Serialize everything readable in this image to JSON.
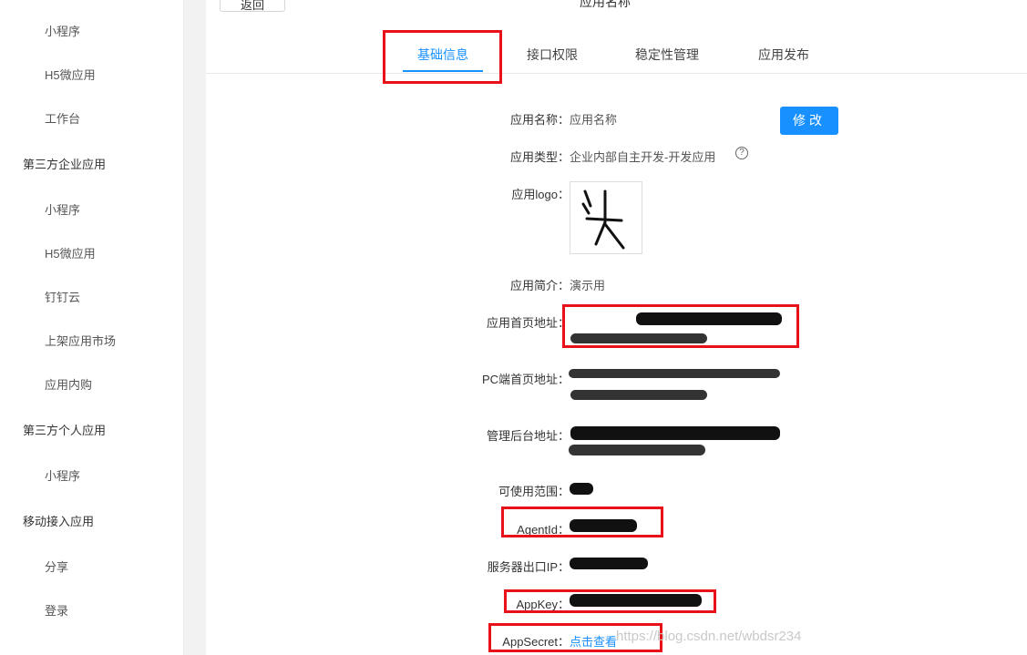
{
  "sidebar": {
    "items": [
      {
        "label": "小程序",
        "kind": "sub"
      },
      {
        "label": "H5微应用",
        "kind": "sub"
      },
      {
        "label": "工作台",
        "kind": "sub"
      },
      {
        "label": "第三方企业应用",
        "kind": "group"
      },
      {
        "label": "小程序",
        "kind": "sub"
      },
      {
        "label": "H5微应用",
        "kind": "sub"
      },
      {
        "label": "钉钉云",
        "kind": "sub"
      },
      {
        "label": "上架应用市场",
        "kind": "sub"
      },
      {
        "label": "应用内购",
        "kind": "sub"
      },
      {
        "label": "第三方个人应用",
        "kind": "group"
      },
      {
        "label": "小程序",
        "kind": "sub"
      },
      {
        "label": "移动接入应用",
        "kind": "group"
      },
      {
        "label": "分享",
        "kind": "sub"
      },
      {
        "label": "登录",
        "kind": "sub"
      }
    ]
  },
  "header": {
    "back_label": "返回",
    "title": "应用名称"
  },
  "tabs": [
    {
      "label": "基础信息",
      "active": true
    },
    {
      "label": "接口权限",
      "active": false
    },
    {
      "label": "稳定性管理",
      "active": false
    },
    {
      "label": "应用发布",
      "active": false
    }
  ],
  "details": {
    "name_label": "应用名称：",
    "name_value": "应用名称",
    "edit_label": "修改",
    "type_label": "应用类型：",
    "type_value": "企业内部自主开发-开发应用",
    "help_glyph": "?",
    "logo_label": "应用logo：",
    "desc_label": "应用简介：",
    "desc_value": "演示用",
    "home_label": "应用首页地址：",
    "pc_home_label": "PC端首页地址：",
    "admin_label": "管理后台地址：",
    "scope_label": "可使用范围：",
    "agentid_label": "AgentId：",
    "ip_label": "服务器出口IP：",
    "appkey_label": "AppKey：",
    "appsecret_label": "AppSecret：",
    "appsecret_link": "点击查看"
  },
  "watermark": "https://blog.csdn.net/wbdsr234",
  "colors": {
    "accent": "#1890ff",
    "highlight": "#e8111a",
    "redaction": "#111111"
  }
}
